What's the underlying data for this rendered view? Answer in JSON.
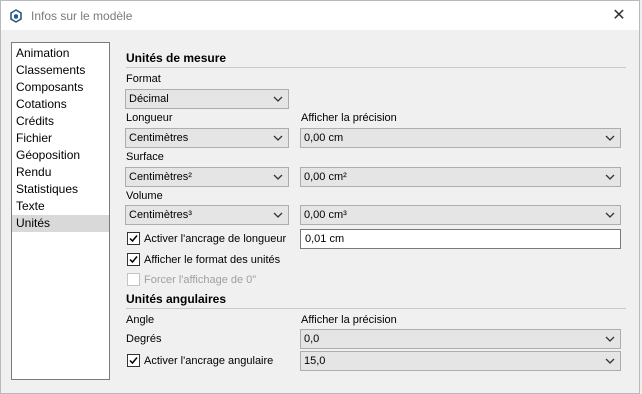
{
  "window": {
    "title": "Infos sur le modèle",
    "close_glyph": "✕"
  },
  "sidebar": {
    "items": [
      {
        "label": "Animation"
      },
      {
        "label": "Classements"
      },
      {
        "label": "Composants"
      },
      {
        "label": "Cotations"
      },
      {
        "label": "Crédits"
      },
      {
        "label": "Fichier"
      },
      {
        "label": "Géoposition"
      },
      {
        "label": "Rendu"
      },
      {
        "label": "Statistiques"
      },
      {
        "label": "Texte"
      },
      {
        "label": "Unités",
        "selected": true
      }
    ]
  },
  "units": {
    "heading": "Unités de mesure",
    "format_label": "Format",
    "format_value": "Décimal",
    "length_label": "Longueur",
    "length_value": "Centimètres",
    "precision_label": "Afficher la précision",
    "length_precision": "0,00 cm",
    "area_label": "Surface",
    "area_value": "Centimètres²",
    "area_precision": "0,00 cm²",
    "volume_label": "Volume",
    "volume_value": "Centimètres³",
    "volume_precision": "0,00 cm³",
    "snap_length_label": "Activer l'ancrage de longueur",
    "snap_length_checked": true,
    "snap_length_value": "0,01 cm",
    "show_format_label": "Afficher le format des unités",
    "show_format_checked": true,
    "force_zero_label": "Forcer l'affichage de 0\"",
    "force_zero_checked": false,
    "force_zero_enabled": false
  },
  "angular": {
    "heading": "Unités angulaires",
    "angle_label": "Angle",
    "precision_label": "Afficher la précision",
    "degrees_label": "Degrés",
    "degrees_precision": "0,0",
    "snap_angle_label": "Activer l'ancrage angulaire",
    "snap_angle_checked": true,
    "snap_angle_value": "15,0"
  },
  "icons": {
    "app": "sketchup-logo-icon",
    "chevron": "chevron-down-icon",
    "check": "checkmark-icon",
    "close": "close-icon"
  },
  "colors": {
    "selection": "#d9d9d9",
    "app_icon": "#2a5a8c"
  }
}
